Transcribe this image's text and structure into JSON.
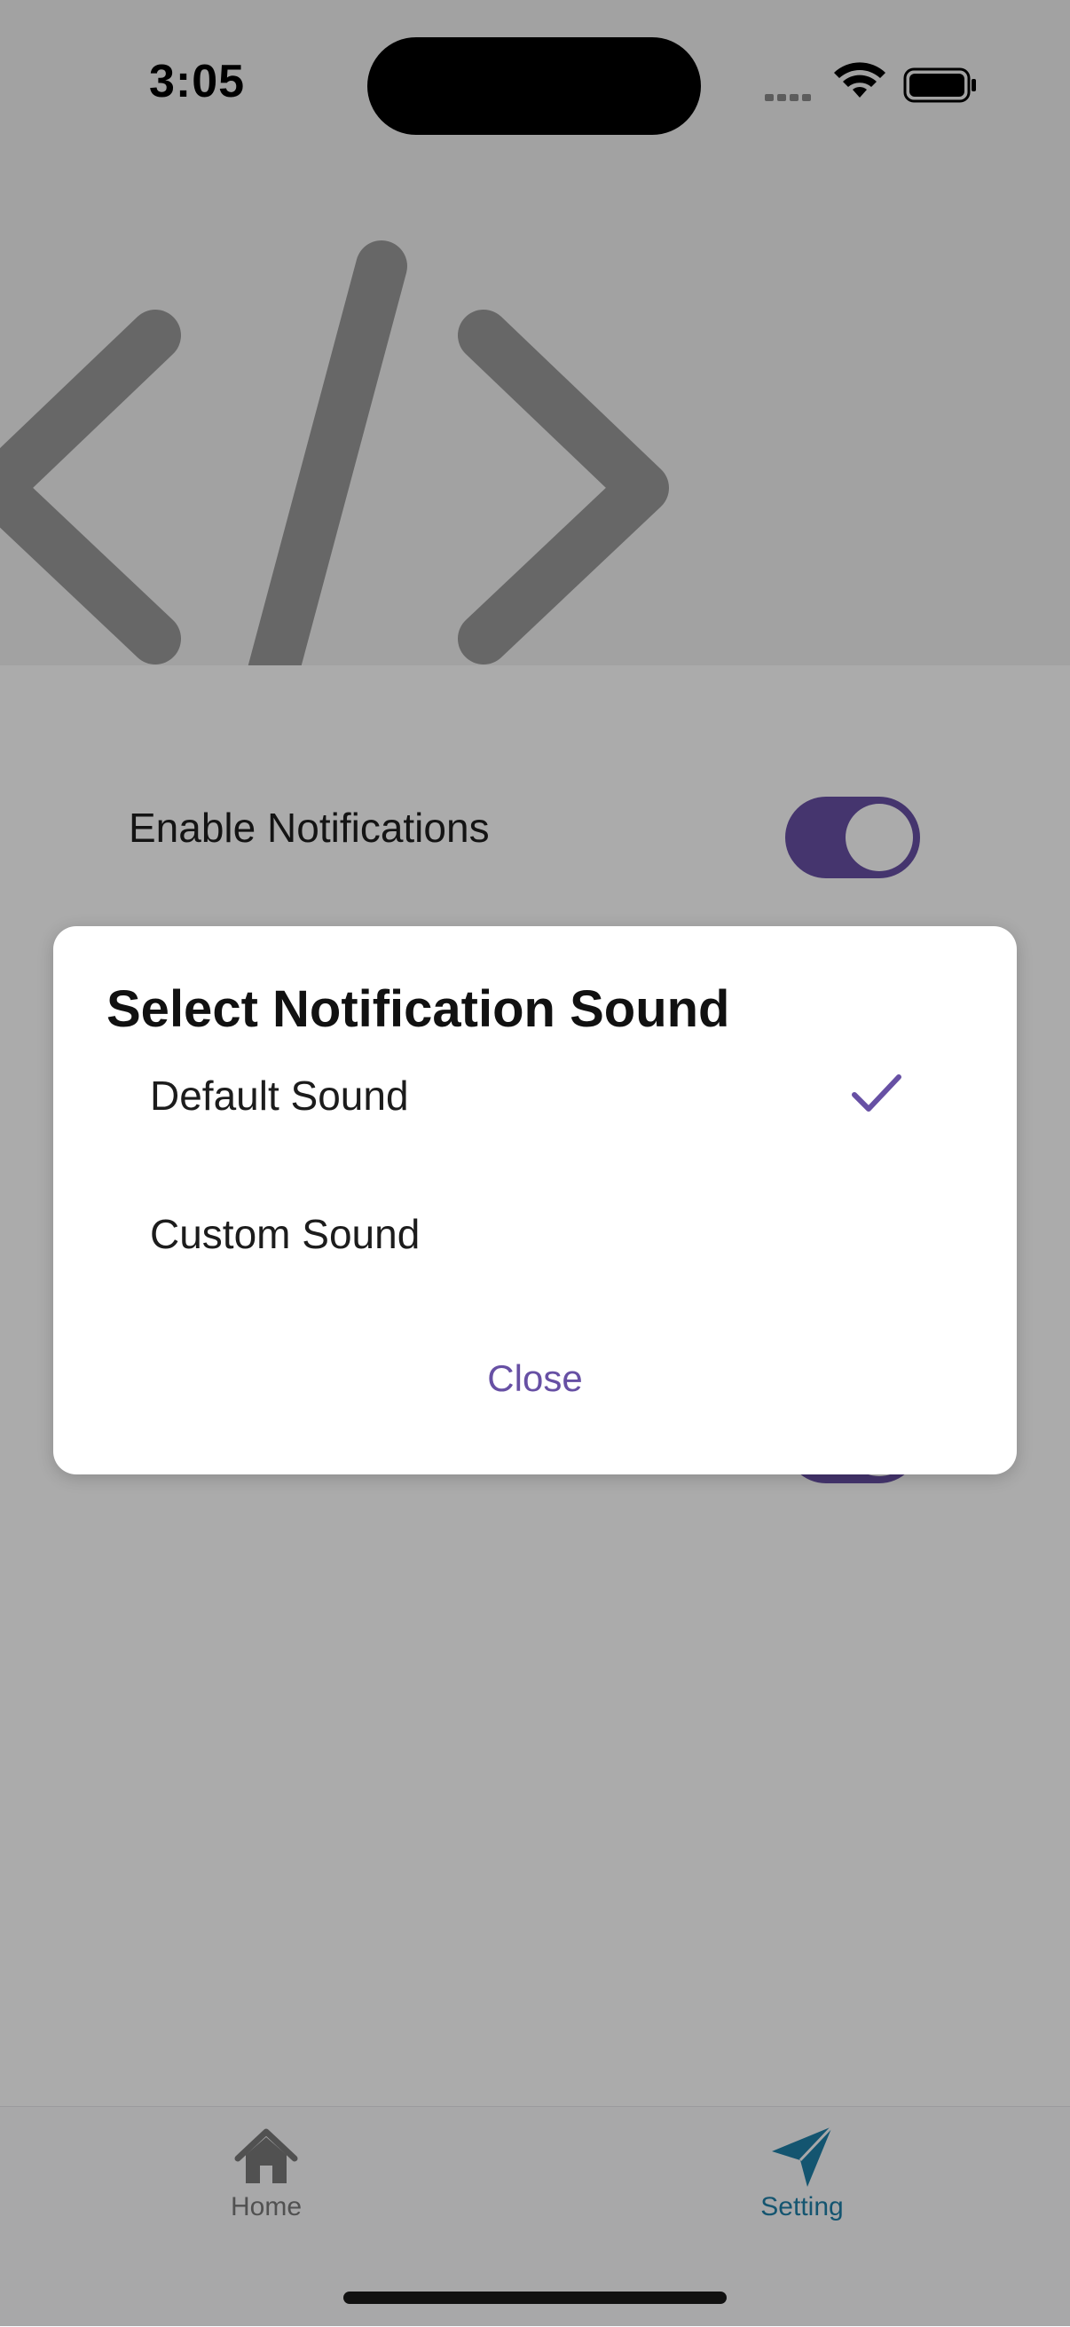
{
  "status_bar": {
    "time": "3:05"
  },
  "settings": {
    "enable_notifications_label": "Enable Notifications",
    "enable_notifications_on": true
  },
  "dialog": {
    "title": "Select Notification Sound",
    "options": [
      {
        "label": "Default Sound",
        "selected": true
      },
      {
        "label": "Custom Sound",
        "selected": false
      }
    ],
    "close_label": "Close"
  },
  "tab_bar": {
    "items": [
      {
        "label": "Home",
        "icon": "home-icon",
        "active": false
      },
      {
        "label": "Setting",
        "icon": "send-icon",
        "active": true
      }
    ]
  },
  "colors": {
    "accent": "#6750a4",
    "active_tab": "#1f7fa8",
    "scrim": "rgba(0,0,0,0.33)"
  }
}
